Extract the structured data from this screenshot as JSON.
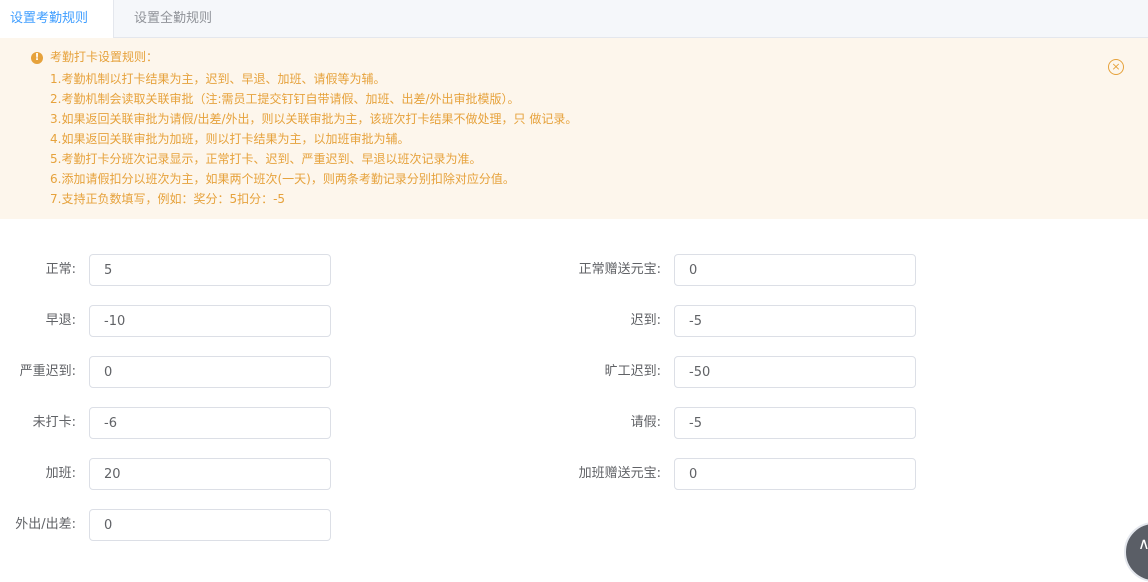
{
  "tabs": [
    {
      "label": "设置考勤规则",
      "active": true
    },
    {
      "label": "设置全勤规则",
      "active": false
    }
  ],
  "alert": {
    "icon": "warning-icon",
    "title": "考勤打卡设置规则：",
    "lines": [
      "1.考勤机制以打卡结果为主，迟到、早退、加班、请假等为辅。",
      "2.考勤机制会读取关联审批（注:需员工提交钉钉自带请假、加班、出差/外出审批模版）。",
      "3.如果返回关联审批为请假/出差/外出，则以关联审批为主，该班次打卡结果不做处理，只 做记录。",
      "4.如果返回关联审批为加班，则以打卡结果为主，以加班审批为辅。",
      "5.考勤打卡分班次记录显示，正常打卡、迟到、严重迟到、早退以班次记录为准。",
      "6.添加请假扣分以班次为主，如果两个班次(一天)，则两条考勤记录分别扣除对应分值。",
      "7.支持正负数填写，例如：奖分：5扣分：-5"
    ],
    "close_icon": "close-circle-icon",
    "color": "#e6a23c",
    "background": "#fdf6ec"
  },
  "form": {
    "normal": {
      "label": "正常:",
      "value": "5"
    },
    "normal_bonus": {
      "label": "正常赠送元宝:",
      "value": "0"
    },
    "leave_early": {
      "label": "早退:",
      "value": "-10"
    },
    "late": {
      "label": "迟到:",
      "value": "-5"
    },
    "severe_late": {
      "label": "严重迟到:",
      "value": "0"
    },
    "absent_late": {
      "label": "旷工迟到:",
      "value": "-50"
    },
    "no_punch": {
      "label": "未打卡:",
      "value": "-6"
    },
    "leave": {
      "label": "请假:",
      "value": "-5"
    },
    "overtime": {
      "label": "加班:",
      "value": "20"
    },
    "overtime_bonus": {
      "label": "加班赠送元宝:",
      "value": "0"
    },
    "out_trip": {
      "label": "外出/出差:",
      "value": "0"
    }
  },
  "colors": {
    "accent": "#409eff",
    "border": "#dcdfe6",
    "text": "#606266"
  }
}
